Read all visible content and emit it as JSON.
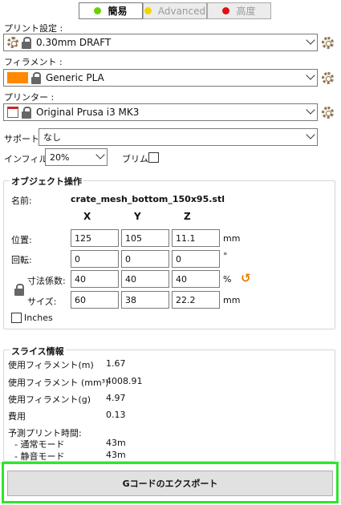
{
  "mode_bar": {
    "simple": {
      "label": "簡易",
      "color": "#6ad100"
    },
    "advanced": {
      "label": "Advanced",
      "color": "#f2d600"
    },
    "expert": {
      "label": "高度",
      "color": "#e01010"
    }
  },
  "print_settings": {
    "label": "プリント設定 :",
    "value": "0.30mm DRAFT"
  },
  "filament": {
    "label": "フィラメント :",
    "value": "Generic PLA",
    "swatch": "#ff8800"
  },
  "printer": {
    "label": "プリンター :",
    "value": "Original Prusa i3 MK3"
  },
  "support": {
    "label": "サポート:",
    "value": "なし"
  },
  "infill": {
    "label": "インフィル:",
    "value": "20%"
  },
  "brim": {
    "label": "ブリム:"
  },
  "object_ops": {
    "title": "オブジェクト操作",
    "name_label": "名前:",
    "name_value": "crate_mesh_bottom_150x95.stl",
    "axes": [
      "X",
      "Y",
      "Z"
    ],
    "position": {
      "label": "位置:",
      "x": "125",
      "y": "105",
      "z": "11.1",
      "unit": "mm"
    },
    "rotation": {
      "label": "回転:",
      "x": "0",
      "y": "0",
      "z": "0",
      "unit": "°"
    },
    "scale": {
      "label": "寸法係数:",
      "x": "40",
      "y": "40",
      "z": "40",
      "unit": "%"
    },
    "size": {
      "label": "サイズ:",
      "x": "60",
      "y": "38",
      "z": "22.2",
      "unit": "mm"
    },
    "inches_label": "Inches"
  },
  "slice_info": {
    "title": "スライス情報",
    "rows": [
      {
        "label": "使用フィラメント(m)",
        "value": "1.67"
      },
      {
        "label": "使用フィラメント (mm³)",
        "value": "4008.91"
      },
      {
        "label": "使用フィラメント(g)",
        "value": "4.97"
      },
      {
        "label": "費用",
        "value": "0.13"
      }
    ],
    "estimated_label": "予測プリント時間:",
    "normal_mode": {
      "label": "- 通常モード",
      "value": "43m"
    },
    "silent_mode": {
      "label": "- 静音モード",
      "value": "43m"
    }
  },
  "export": {
    "label": "Gコードのエクスポート"
  }
}
